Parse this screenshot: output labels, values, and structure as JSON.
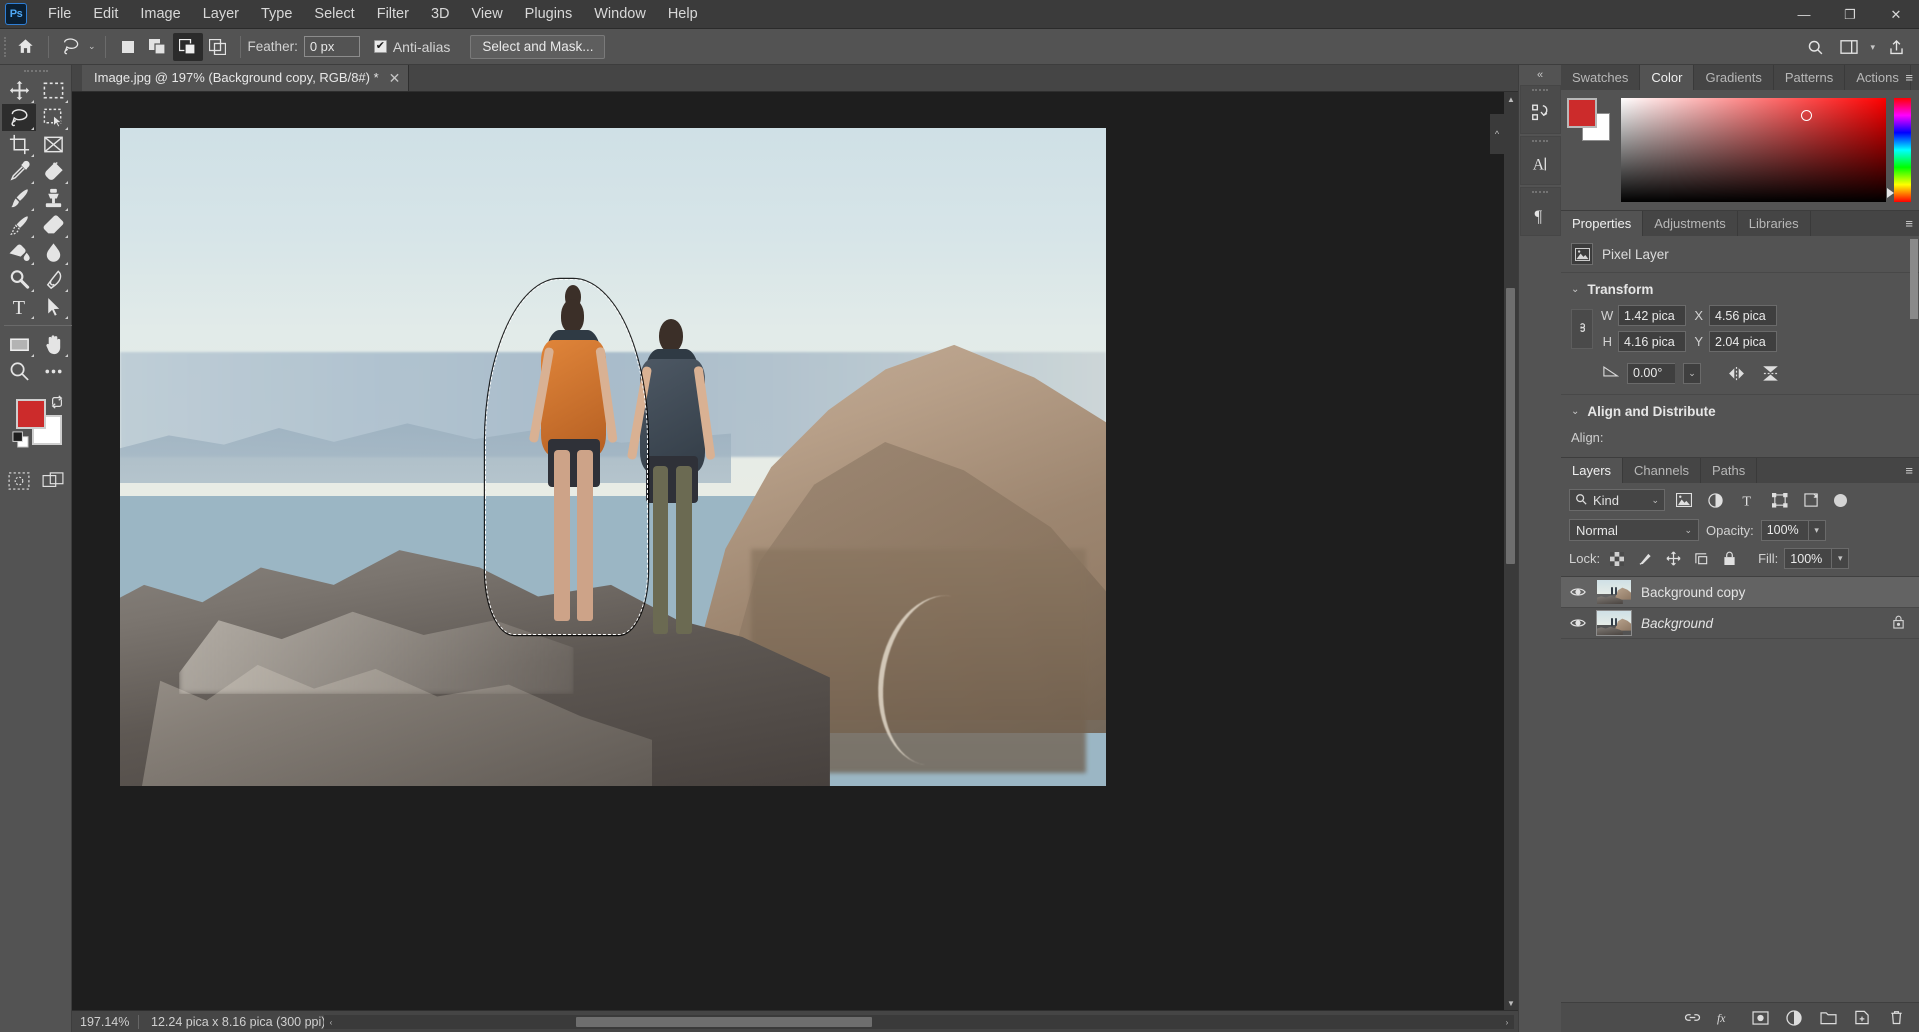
{
  "app": {
    "name": "Ps",
    "logo_text": "Ps"
  },
  "menubar": {
    "items": [
      {
        "label": "File"
      },
      {
        "label": "Edit"
      },
      {
        "label": "Image"
      },
      {
        "label": "Layer"
      },
      {
        "label": "Type"
      },
      {
        "label": "Select"
      },
      {
        "label": "Filter"
      },
      {
        "label": "3D"
      },
      {
        "label": "View"
      },
      {
        "label": "Plugins"
      },
      {
        "label": "Window"
      },
      {
        "label": "Help"
      }
    ],
    "window_controls": {
      "minimize": "—",
      "maximize": "❐",
      "close": "✕"
    }
  },
  "options_bar": {
    "home_icon": "home-icon",
    "tool_icon": "lasso-tool-icon",
    "tool_preset_chevron": "⌄",
    "selection_modes": [
      {
        "name": "new-selection",
        "active": false
      },
      {
        "name": "add-to-selection",
        "active": false
      },
      {
        "name": "subtract-from-selection",
        "active": true
      },
      {
        "name": "intersect-with-selection",
        "active": false
      }
    ],
    "feather_label": "Feather:",
    "feather_value": "0 px",
    "antialias_label": "Anti-alias",
    "antialias_checked": true,
    "check_glyph": "✔",
    "select_and_mask_label": "Select and Mask...",
    "search_icon": "search-icon",
    "workspace_icon": "workspace-icon",
    "share_icon": "share-icon"
  },
  "toolbar": {
    "tools": [
      {
        "name": "move-tool",
        "active": false,
        "has_more": true
      },
      {
        "name": "rectangular-marquee-tool",
        "active": false,
        "has_more": true
      },
      {
        "name": "lasso-tool",
        "active": true,
        "has_more": true
      },
      {
        "name": "object-selection-tool",
        "active": false,
        "has_more": true
      },
      {
        "name": "crop-tool",
        "active": false,
        "has_more": true
      },
      {
        "name": "frame-tool",
        "active": false,
        "has_more": false
      },
      {
        "name": "eyedropper-tool",
        "active": false,
        "has_more": true
      },
      {
        "name": "spot-healing-brush-tool",
        "active": false,
        "has_more": true
      },
      {
        "name": "brush-tool",
        "active": false,
        "has_more": true
      },
      {
        "name": "clone-stamp-tool",
        "active": false,
        "has_more": true
      },
      {
        "name": "history-brush-tool",
        "active": false,
        "has_more": true
      },
      {
        "name": "eraser-tool",
        "active": false,
        "has_more": true
      },
      {
        "name": "gradient-tool",
        "active": false,
        "has_more": true
      },
      {
        "name": "blur-tool",
        "active": false,
        "has_more": true
      },
      {
        "name": "dodge-tool",
        "active": false,
        "has_more": true
      },
      {
        "name": "pen-tool",
        "active": false,
        "has_more": true
      },
      {
        "name": "type-tool",
        "active": false,
        "has_more": true
      },
      {
        "name": "path-selection-tool",
        "active": false,
        "has_more": true
      },
      {
        "name": "rectangle-tool",
        "active": false,
        "has_more": true
      },
      {
        "name": "hand-tool",
        "active": false,
        "has_more": true
      },
      {
        "name": "zoom-tool",
        "active": false,
        "has_more": false
      },
      {
        "name": "edit-toolbar-more",
        "active": false,
        "has_more": false
      }
    ],
    "foreground_color": "#cc2b2b",
    "background_color": "#ffffff",
    "swap_colors_icon": "swap-colors-icon",
    "default_colors_icon": "default-colors-icon",
    "quick_mask_icon": "quick-mask-icon",
    "screen_mode_icon": "screen-mode-icon"
  },
  "document": {
    "tab_title": "Image.jpg @ 197% (Background copy, RGB/8#) *",
    "close_glyph": "✕"
  },
  "status_bar": {
    "zoom": "197.14%",
    "doc_size": "12.24 pica x 8.16 pica (300 ppi)",
    "expand_glyph": "❯",
    "left_arrow": "‹",
    "right_arrow": "›"
  },
  "icon_dock": {
    "collapse_glyph": "«",
    "items": [
      {
        "name": "history-icon"
      },
      {
        "name": "character-icon"
      },
      {
        "name": "paragraph-icon"
      }
    ]
  },
  "color_panel": {
    "tabs": [
      {
        "label": "Swatches",
        "active": false
      },
      {
        "label": "Color",
        "active": true
      },
      {
        "label": "Gradients",
        "active": false
      },
      {
        "label": "Patterns",
        "active": false
      },
      {
        "label": "Actions",
        "active": false
      }
    ],
    "menu_glyph": "≡",
    "foreground_color": "#cc2b2b",
    "background_color": "#ffffff",
    "picker_hue": "#ff0000"
  },
  "properties_panel": {
    "tabs": [
      {
        "label": "Properties",
        "active": true
      },
      {
        "label": "Adjustments",
        "active": false
      },
      {
        "label": "Libraries",
        "active": false
      }
    ],
    "menu_glyph": "≡",
    "layer_type_icon": "pixel-layer-icon",
    "layer_type": "Pixel Layer",
    "transform": {
      "section_title": "Transform",
      "chevron": "⌄",
      "link_icon": "link-wh-icon",
      "w_label": "W",
      "w_value": "1.42 pica",
      "x_label": "X",
      "x_value": "4.56 pica",
      "h_label": "H",
      "h_value": "4.16 pica",
      "y_label": "Y",
      "y_value": "2.04 pica",
      "angle_icon": "angle-icon",
      "angle_value": "0.00°",
      "angle_chevron": "⌄",
      "flip_horizontal_icon": "flip-horizontal-icon",
      "flip_vertical_icon": "flip-vertical-icon"
    },
    "align": {
      "section_title": "Align and Distribute",
      "chevron": "⌄",
      "align_label": "Align:"
    }
  },
  "layers_panel": {
    "tabs": [
      {
        "label": "Layers",
        "active": true
      },
      {
        "label": "Channels",
        "active": false
      },
      {
        "label": "Paths",
        "active": false
      }
    ],
    "menu_glyph": "≡",
    "filter": {
      "search_icon": "search-icon",
      "kind_label": "Kind",
      "chevron": "⌄",
      "icons": [
        {
          "name": "filter-pixel-icon"
        },
        {
          "name": "filter-adjustment-icon"
        },
        {
          "name": "filter-type-icon"
        },
        {
          "name": "filter-shape-icon"
        },
        {
          "name": "filter-smart-object-icon"
        }
      ],
      "toggle_name": "filter-toggle"
    },
    "blend_mode": "Normal",
    "blend_chevron": "⌄",
    "opacity_label": "Opacity:",
    "opacity_value": "100%",
    "lock_label": "Lock:",
    "lock_icons": [
      {
        "name": "lock-transparent-pixels-icon"
      },
      {
        "name": "lock-image-pixels-icon"
      },
      {
        "name": "lock-position-icon"
      },
      {
        "name": "lock-artboard-nesting-icon"
      },
      {
        "name": "lock-all-icon"
      }
    ],
    "fill_label": "Fill:",
    "fill_value": "100%",
    "layers": [
      {
        "name": "Background copy",
        "visible": true,
        "selected": true,
        "locked": false,
        "italic": false,
        "eye_glyph": "◉"
      },
      {
        "name": "Background",
        "visible": true,
        "selected": false,
        "locked": true,
        "italic": true,
        "eye_glyph": "◉"
      }
    ],
    "footer_icons": [
      {
        "name": "link-layers-icon"
      },
      {
        "name": "layer-style-fx-icon"
      },
      {
        "name": "add-layer-mask-icon"
      },
      {
        "name": "new-adjustment-layer-icon"
      },
      {
        "name": "new-group-icon"
      },
      {
        "name": "new-layer-icon"
      },
      {
        "name": "delete-layer-icon"
      }
    ]
  },
  "canvas": {
    "image_name": "Image.jpg",
    "selection_active": true,
    "vertical_scrollbar": "canvas-vertical-scrollbar",
    "horizontal_scrollbar": "canvas-horizontal-scrollbar"
  }
}
